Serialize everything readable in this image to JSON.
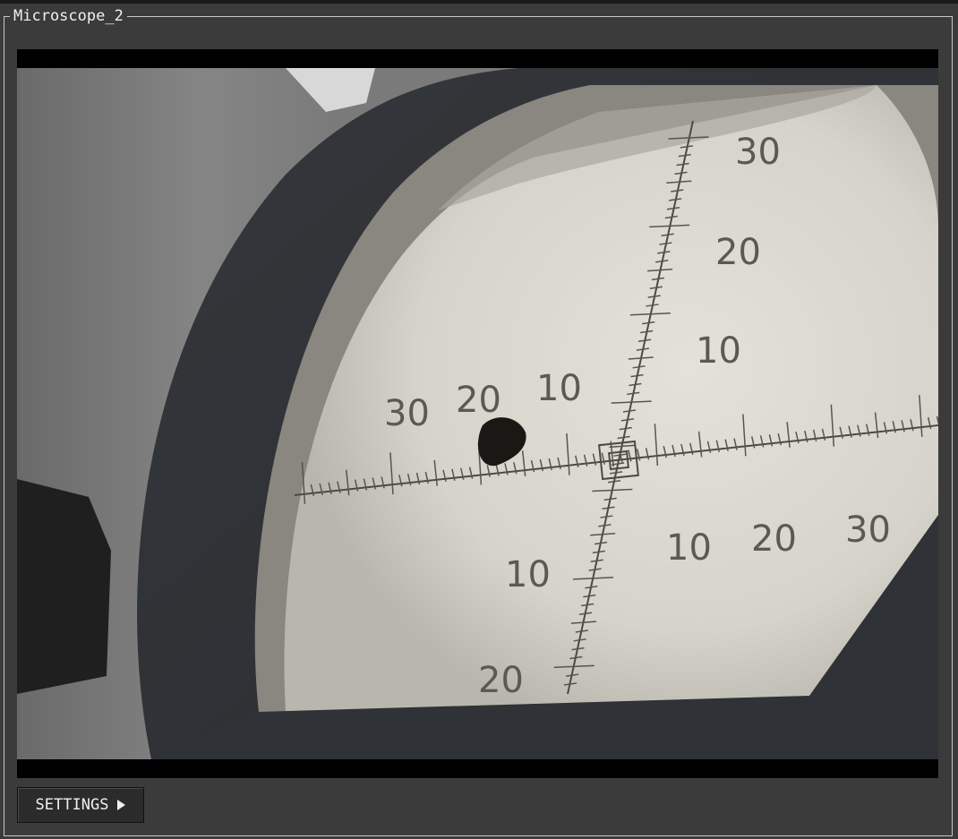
{
  "window": {
    "group_title": "Microscope_2"
  },
  "viewer": {
    "scale_labels_top": [
      "30",
      "20",
      "10"
    ],
    "scale_labels_left": [
      "30",
      "20",
      "10"
    ],
    "scale_labels_right": [
      "10",
      "20",
      "30"
    ],
    "scale_labels_bottom": [
      "10",
      "20"
    ]
  },
  "controls": {
    "settings_label": "SETTINGS",
    "settings_icon": "play-triangle-icon"
  }
}
